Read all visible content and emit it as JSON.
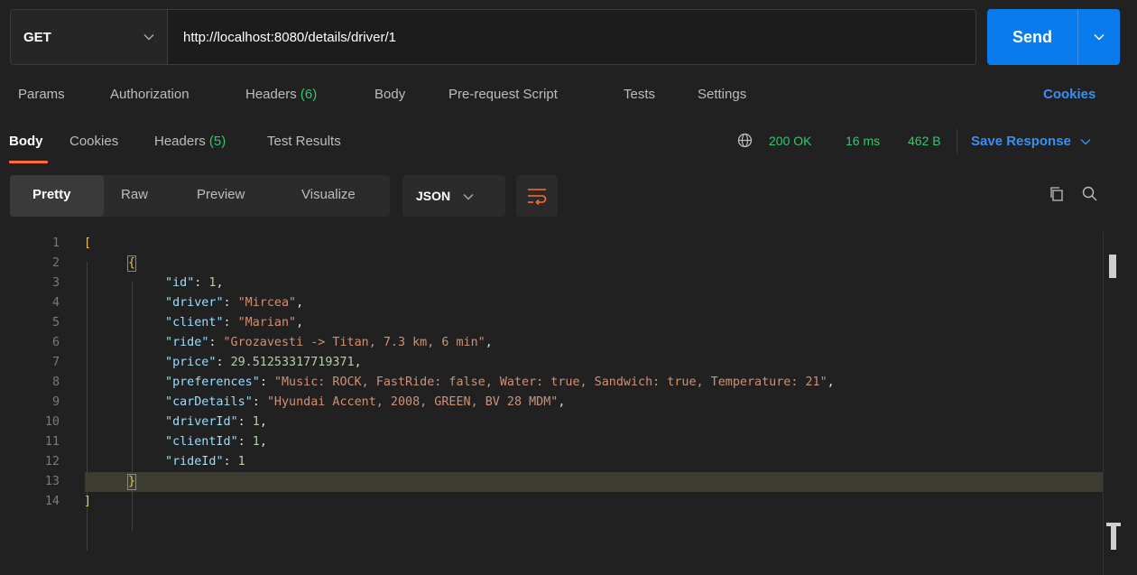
{
  "request": {
    "method": "GET",
    "url": "http://localhost:8080/details/driver/1",
    "send_label": "Send"
  },
  "request_tabs": {
    "params": "Params",
    "authorization": "Authorization",
    "headers": "Headers",
    "headers_count": "(6)",
    "body": "Body",
    "prerequest": "Pre-request Script",
    "tests": "Tests",
    "settings": "Settings",
    "cookies": "Cookies"
  },
  "response_tabs": {
    "body": "Body",
    "cookies": "Cookies",
    "headers": "Headers",
    "headers_count": "(5)",
    "test_results": "Test Results"
  },
  "response_status": {
    "status": "200 OK",
    "time": "16 ms",
    "size": "462 B",
    "save_response": "Save Response"
  },
  "format_toolbar": {
    "pretty": "Pretty",
    "raw": "Raw",
    "preview": "Preview",
    "visualize": "Visualize",
    "language": "JSON"
  },
  "editor": {
    "line_numbers": [
      "1",
      "2",
      "3",
      "4",
      "5",
      "6",
      "7",
      "8",
      "9",
      "10",
      "11",
      "12",
      "13",
      "14"
    ],
    "open_bracket": "[",
    "close_bracket": "]",
    "open_brace": "{",
    "close_brace": "}",
    "fields": [
      {
        "key": "id",
        "value": "1",
        "kind": "num",
        "sep": ","
      },
      {
        "key": "driver",
        "value": "\"Mircea\"",
        "kind": "str",
        "sep": ","
      },
      {
        "key": "client",
        "value": "\"Marian\"",
        "kind": "str",
        "sep": ","
      },
      {
        "key": "ride",
        "value": "\"Grozavesti -> Titan, 7.3 km, 6 min\"",
        "kind": "str",
        "sep": ","
      },
      {
        "key": "price",
        "value": "29.51253317719371",
        "kind": "num",
        "sep": ","
      },
      {
        "key": "preferences",
        "value": "\"Music: ROCK, FastRide: false, Water: true, Sandwich: true, Temperature: 21\"",
        "kind": "str",
        "sep": ","
      },
      {
        "key": "carDetails",
        "value": "\"Hyundai Accent, 2008, GREEN, BV 28 MDM\"",
        "kind": "str",
        "sep": ","
      },
      {
        "key": "driverId",
        "value": "1",
        "kind": "num",
        "sep": ","
      },
      {
        "key": "clientId",
        "value": "1",
        "kind": "num",
        "sep": ","
      },
      {
        "key": "rideId",
        "value": "1",
        "kind": "num",
        "sep": ""
      }
    ]
  },
  "colors": {
    "send_button": "#097bed",
    "accent_link": "#3c8ff0",
    "status_green": "#39c46f",
    "active_tab_underline": "#ff6c37"
  },
  "icons": [
    "chevron-down-icon",
    "globe-icon",
    "wrap-lines-icon",
    "copy-icon",
    "search-icon"
  ]
}
